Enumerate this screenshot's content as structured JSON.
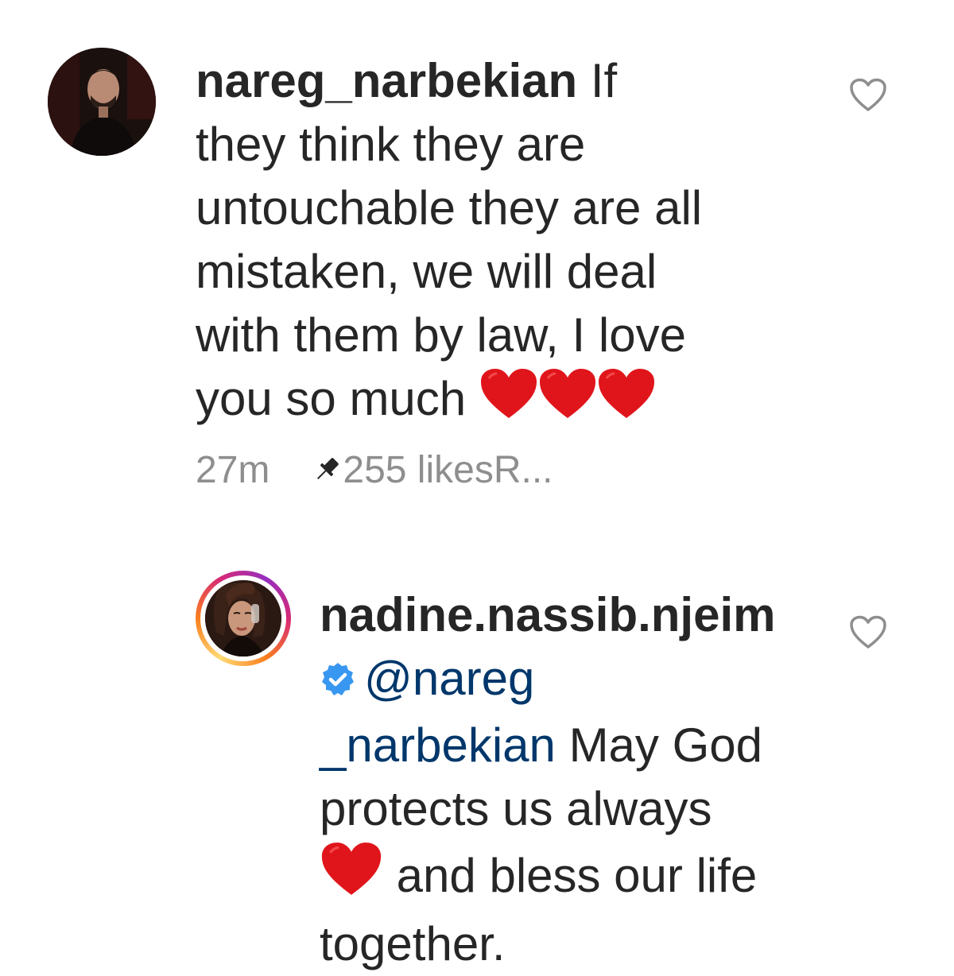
{
  "comments": [
    {
      "username": "nareg_narbekian",
      "line1": " If",
      "line2": "they think they are",
      "line3": "untouchable they are all",
      "line4": "mistaken, we will deal",
      "line5": "with them by law, I love",
      "line6": "you so much",
      "time": "27m",
      "likes": "255 likes",
      "reply_label": "R...",
      "icons": [
        "avatar",
        "red-heart-emoji",
        "pin-icon",
        "heart-outline-icon"
      ]
    },
    {
      "username": "nadine.nassib.njeim",
      "mention_a": "@nareg",
      "mention_b": "_narbekian",
      "text_a": " May God",
      "text_b": "protects us  always",
      "text_c": " and bless our life",
      "text_d": "together.",
      "icons": [
        "avatar",
        "verified-badge-icon",
        "red-heart-emoji",
        "heart-outline-icon"
      ]
    }
  ],
  "colors": {
    "text": "#262626",
    "muted": "#8e8e8e",
    "mention": "#00376b",
    "heart": "#e0151b",
    "verified": "#3897f0"
  }
}
